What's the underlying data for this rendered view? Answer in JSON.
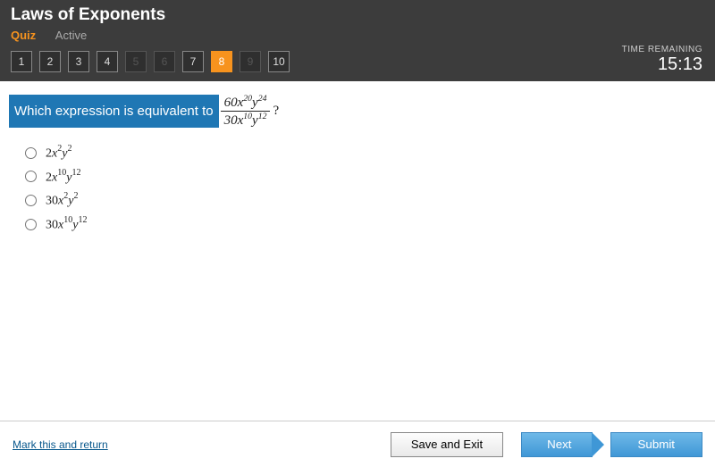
{
  "header": {
    "title": "Laws of Exponents",
    "tab_quiz": "Quiz",
    "tab_active": "Active"
  },
  "timer": {
    "label": "TIME REMAINING",
    "value": "15:13"
  },
  "nav": {
    "items": [
      "1",
      "2",
      "3",
      "4",
      "5",
      "6",
      "7",
      "8",
      "9",
      "10"
    ],
    "current_index": 7,
    "dim_indices": [
      4,
      5,
      8
    ]
  },
  "question": {
    "stem_text": "Which expression is equivalent to",
    "fraction": {
      "num_coef": "60",
      "num_x_exp": "20",
      "num_y_exp": "24",
      "den_coef": "30",
      "den_x_exp": "10",
      "den_y_exp": "12"
    },
    "qmark": "?"
  },
  "options": [
    {
      "coef": "2",
      "x_exp": "2",
      "y_exp": "2"
    },
    {
      "coef": "2",
      "x_exp": "10",
      "y_exp": "12"
    },
    {
      "coef": "30",
      "x_exp": "2",
      "y_exp": "2"
    },
    {
      "coef": "30",
      "x_exp": "10",
      "y_exp": "12"
    }
  ],
  "footer": {
    "mark": "Mark this and return",
    "save": "Save and Exit",
    "next": "Next",
    "submit": "Submit"
  }
}
